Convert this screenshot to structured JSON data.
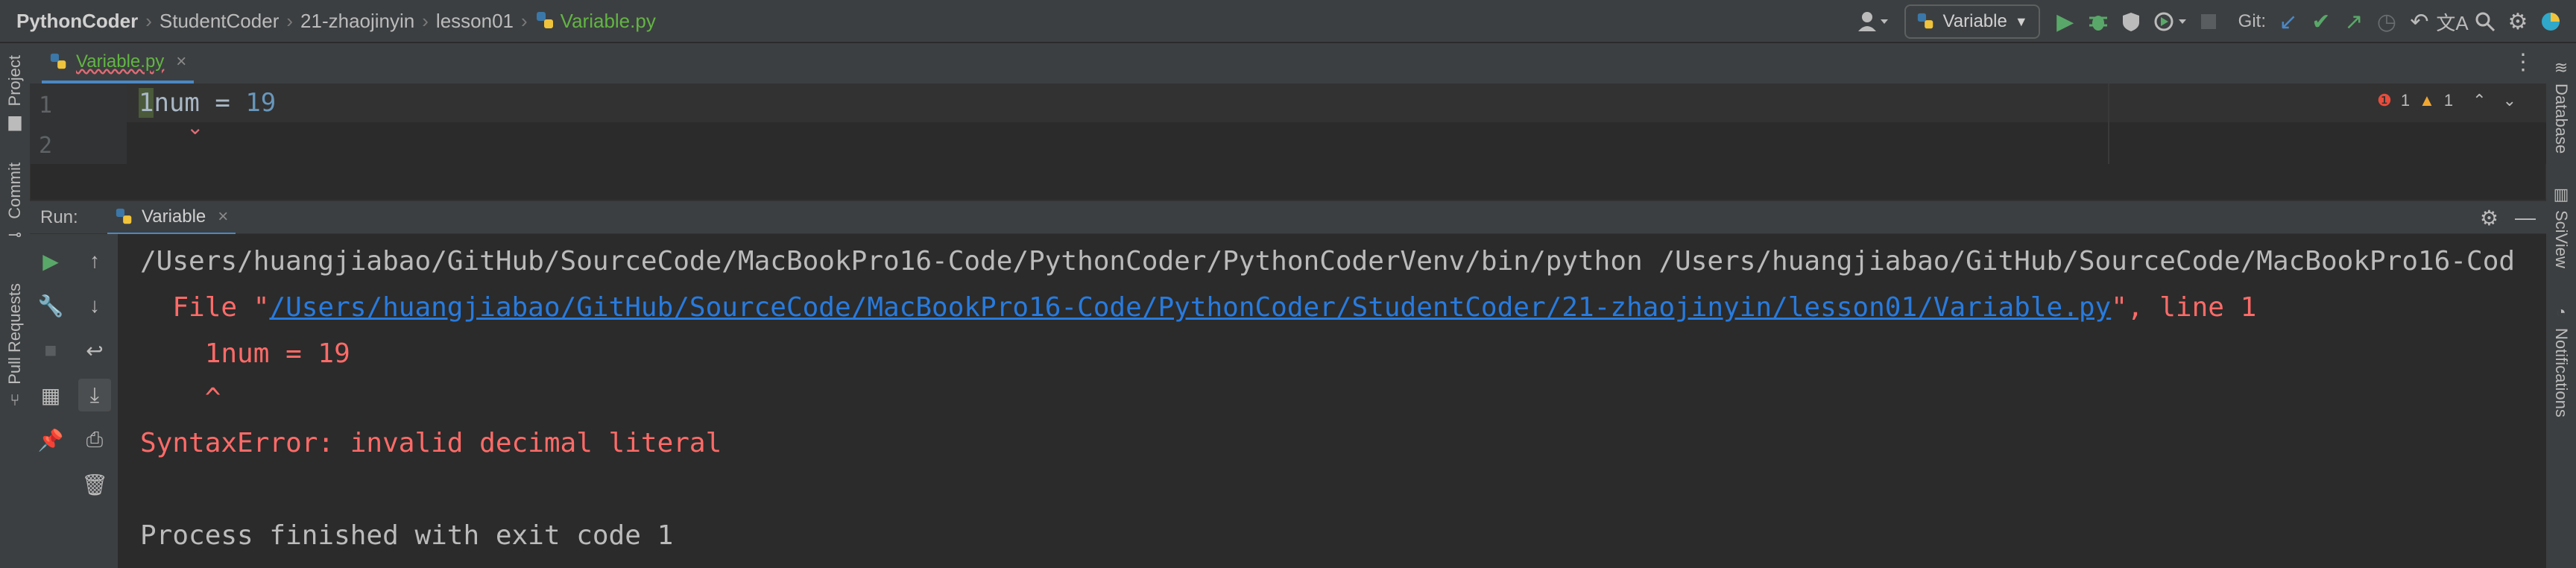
{
  "breadcrumbs": {
    "project": "PythonCoder",
    "items": [
      "StudentCoder",
      "21-zhaojinyin",
      "lesson01"
    ],
    "file": "Variable.py"
  },
  "toolbar": {
    "run_config": "Variable",
    "git_label": "Git:"
  },
  "left_strip": {
    "project": "Project",
    "commit": "Commit",
    "pull_requests": "Pull Requests"
  },
  "right_strip": {
    "database": "Database",
    "sciview": "SciView",
    "notifications": "Notifications"
  },
  "editor": {
    "tab": "Variable.py",
    "line_numbers": [
      "1",
      "2"
    ],
    "code": {
      "line1_digit": "1",
      "line1_ident": "num = ",
      "line1_value": "19"
    },
    "inspections": {
      "errors": "1",
      "warnings": "1"
    }
  },
  "run": {
    "label": "Run:",
    "tab": "Variable",
    "console": {
      "command": "/Users/huangjiabao/GitHub/SourceCode/MacBookPro16-Code/PythonCoder/PythonCoderVenv/bin/python /Users/huangjiabao/GitHub/SourceCode/MacBookPro16-Cod",
      "file_prefix": "  File \"",
      "file_path": "/Users/huangjiabao/GitHub/SourceCode/MacBookPro16-Code/PythonCoder/StudentCoder/21-zhaojinyin/lesson01/Variable.py",
      "file_suffix": "\", line 1",
      "code_line": "    1num = 19",
      "caret_line": "    ^",
      "error": "SyntaxError: invalid decimal literal",
      "finished": "Process finished with exit code 1"
    }
  },
  "colors": {
    "background": "#2b2b2b",
    "panel": "#3c3f41",
    "error_text": "#ff6b68",
    "link": "#287bde",
    "file_green": "#62b543",
    "run_green": "#59a869"
  }
}
